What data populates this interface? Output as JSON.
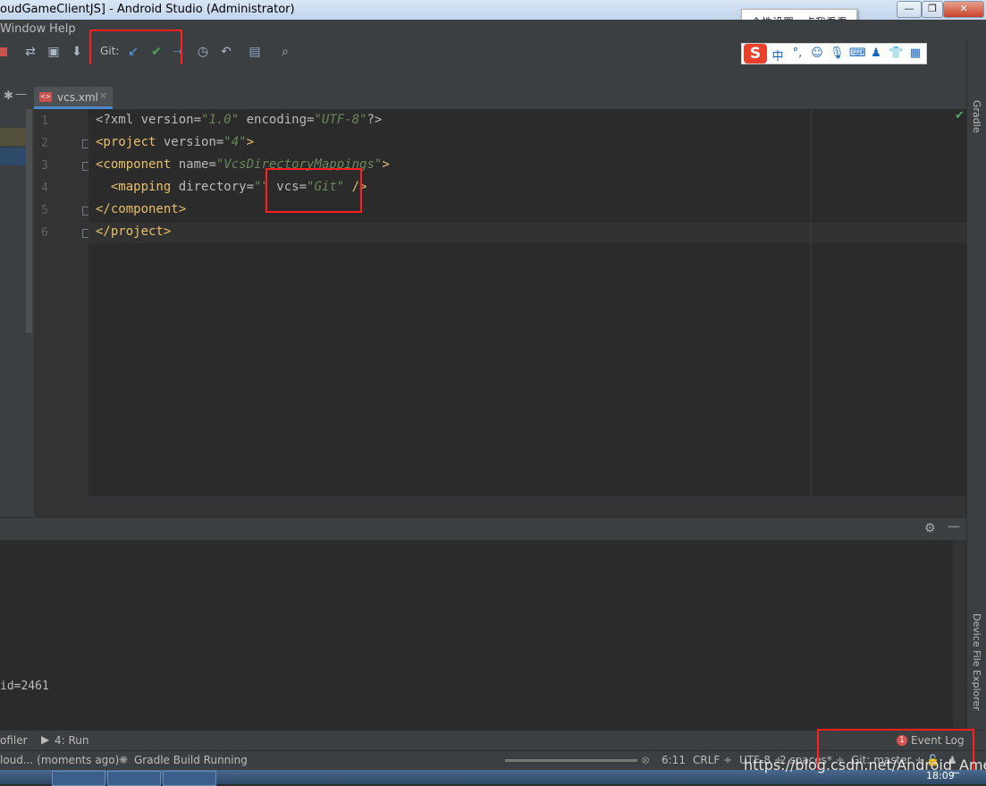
{
  "window": {
    "title": "oudGameClientJS] - Android Studio (Administrator)",
    "controls": [
      "—",
      "❐",
      "✕"
    ]
  },
  "menu": {
    "items": [
      "Window",
      "Help"
    ]
  },
  "toolbar": {
    "git_label": "Git:"
  },
  "ime": {
    "tooltip": "个性设置，点我看看",
    "logo": "S",
    "lang": "中",
    "punct": "°,"
  },
  "editor": {
    "tab_label": "vcs.xml",
    "line_numbers": [
      "1",
      "2",
      "3",
      "4",
      "5",
      "6"
    ],
    "lines": [
      [
        {
          "t": "<?xml version=",
          "c": "attr"
        },
        {
          "t": "\"1.0\"",
          "c": "str"
        },
        {
          "t": " encoding=",
          "c": "attr"
        },
        {
          "t": "\"UTF-8\"",
          "c": "str"
        },
        {
          "t": "?>",
          "c": "attr"
        }
      ],
      [
        {
          "t": "<project",
          "c": "tag"
        },
        {
          "t": " version=",
          "c": "attr"
        },
        {
          "t": "\"4\"",
          "c": "str"
        },
        {
          "t": ">",
          "c": "tag"
        }
      ],
      [
        {
          "t": "<component",
          "c": "tag"
        },
        {
          "t": " name=",
          "c": "attr"
        },
        {
          "t": "\"VcsDirectoryMappings\"",
          "c": "str"
        },
        {
          "t": ">",
          "c": "tag"
        }
      ],
      [
        {
          "t": "  <mapping",
          "c": "tag"
        },
        {
          "t": " directory=",
          "c": "attr"
        },
        {
          "t": "\"\"",
          "c": "str"
        },
        {
          "t": " vcs=",
          "c": "attr"
        },
        {
          "t": "\"Git\"",
          "c": "str"
        },
        {
          "t": " />",
          "c": "tag"
        }
      ],
      [
        {
          "t": "</component>",
          "c": "tag"
        }
      ],
      [
        {
          "t": "</project>",
          "c": "tag"
        }
      ]
    ]
  },
  "right_panels": {
    "gradle": "Gradle",
    "device_explorer": "Device File Explorer"
  },
  "console": {
    "line": "id=2461"
  },
  "tool_windows": {
    "profiler": "ofiler",
    "run": "4: Run",
    "event_log": "Event Log",
    "event_count": "1"
  },
  "status": {
    "message": "loud... (moments ago)",
    "build": "Gradle Build Running",
    "position": "6:11",
    "line_sep": "CRLF ÷",
    "encoding": "UTF-8 ÷",
    "indent": "2 spaces* ÷",
    "vcs": "Git: master ÷"
  },
  "taskbar": {
    "clock": "18:09"
  },
  "watermark": "https://blog.csdn.net/Android_Amelia"
}
